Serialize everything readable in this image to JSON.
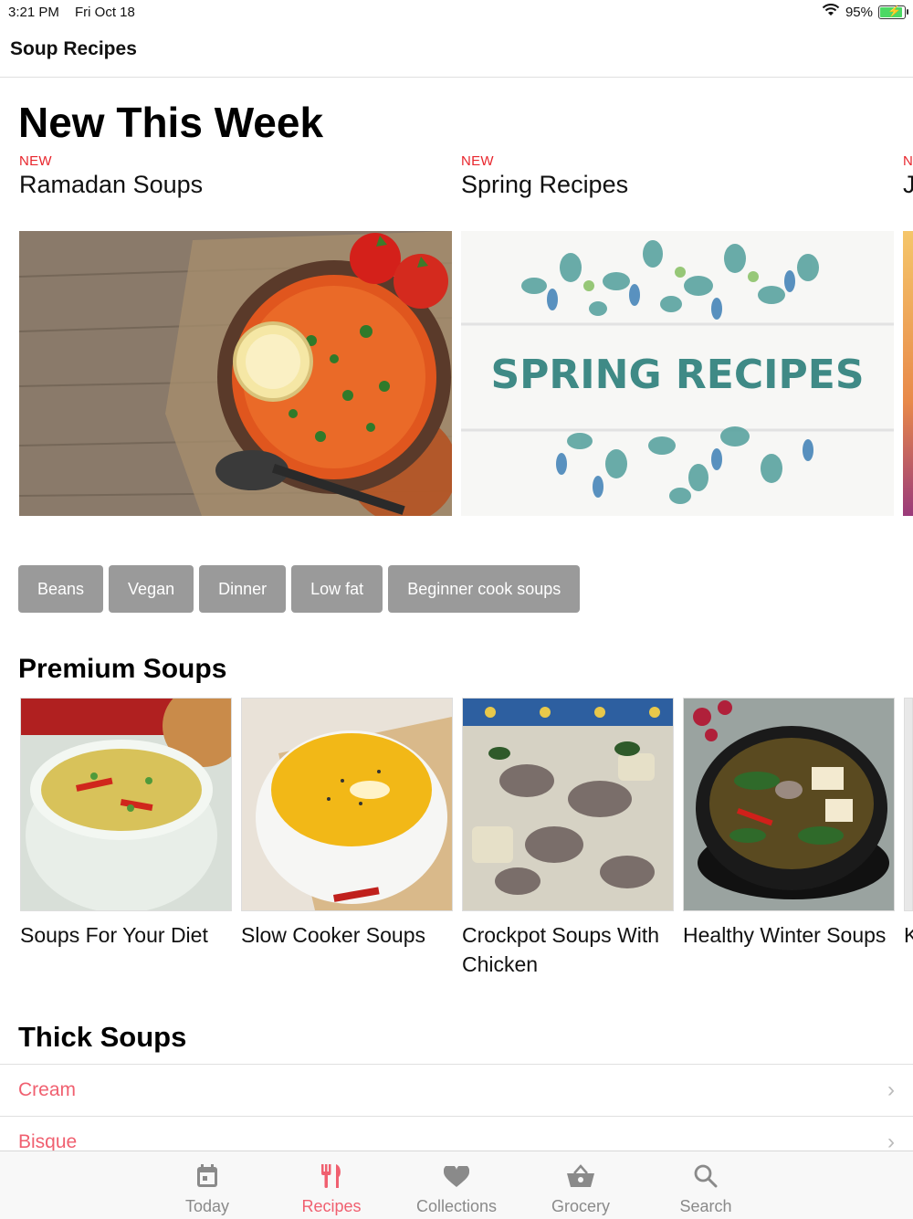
{
  "status": {
    "time": "3:21 PM",
    "date": "Fri Oct 18",
    "battery": "95%"
  },
  "nav": {
    "title": "Soup Recipes"
  },
  "new_week": {
    "title": "New This Week",
    "items": [
      {
        "tag": "NEW",
        "name": "Ramadan Soups"
      },
      {
        "tag": "NEW",
        "name": "Spring Recipes"
      },
      {
        "tag": "N",
        "name": "J"
      }
    ],
    "spring_banner_text": "SPRING RECIPES"
  },
  "chips": [
    "Beans",
    "Vegan",
    "Dinner",
    "Low fat",
    "Beginner cook soups"
  ],
  "premium": {
    "title": "Premium Soups",
    "items": [
      {
        "caption": "Soups For Your Diet"
      },
      {
        "caption": "Slow Cooker Soups"
      },
      {
        "caption": "Crockpot Soups With Chicken"
      },
      {
        "caption": "Healthy Winter Soups"
      },
      {
        "caption": "K"
      }
    ]
  },
  "thick": {
    "title": "Thick Soups",
    "items": [
      {
        "label": "Cream"
      },
      {
        "label": "Bisque"
      }
    ]
  },
  "tabs": [
    {
      "label": "Today",
      "icon": "calendar-icon",
      "active": false
    },
    {
      "label": "Recipes",
      "icon": "fork-knife-icon",
      "active": true
    },
    {
      "label": "Collections",
      "icon": "heart-icon",
      "active": false
    },
    {
      "label": "Grocery",
      "icon": "basket-icon",
      "active": false
    },
    {
      "label": "Search",
      "icon": "search-icon",
      "active": false
    }
  ],
  "colors": {
    "accent": "#f06070",
    "new_tag": "#e8252c",
    "chip": "#9a9a9a"
  }
}
